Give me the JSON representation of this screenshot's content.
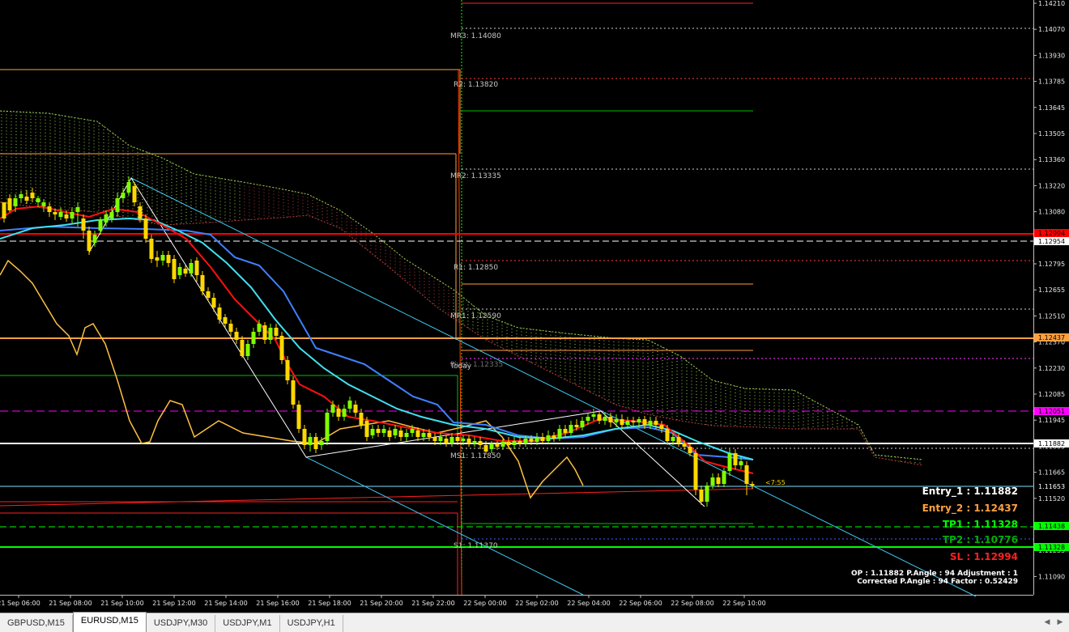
{
  "price_axis": {
    "ticks": [
      "1.14210",
      "1.14070",
      "1.13930",
      "1.13785",
      "1.13645",
      "1.13505",
      "1.13360",
      "1.13220",
      "1.13080",
      "1.12935",
      "1.12795",
      "1.12655",
      "1.12510",
      "1.12370",
      "1.12230",
      "1.12085",
      "1.11945",
      "1.11805",
      "1.11665",
      "1.11520",
      "1.11380",
      "1.11235",
      "1.11090"
    ],
    "tags": [
      {
        "text": "1.12994",
        "bg": "#ff0000",
        "fg": "#000000"
      },
      {
        "text": "1.12954",
        "bg": "#ffffff",
        "fg": "#000000"
      },
      {
        "text": "1.12437",
        "bg": "#ffa040",
        "fg": "#000000"
      },
      {
        "text": "1.12051",
        "bg": "#ff00ff",
        "fg": "#000000"
      },
      {
        "text": "1.11882",
        "bg": "#ffffff",
        "fg": "#000000"
      },
      {
        "text": "1.11653",
        "bg": "#000000",
        "fg": "#ffffff"
      },
      {
        "text": "1.11438",
        "bg": "#00ff00",
        "fg": "#000000"
      },
      {
        "text": "1.11328",
        "bg": "#00ff00",
        "fg": "#000000"
      }
    ]
  },
  "time_axis": [
    "21 Sep 06:00",
    "21 Sep 08:00",
    "21 Sep 10:00",
    "21 Sep 12:00",
    "21 Sep 14:00",
    "21 Sep 16:00",
    "21 Sep 18:00",
    "21 Sep 20:00",
    "21 Sep 22:00",
    "22 Sep 00:00",
    "22 Sep 02:00",
    "22 Sep 04:00",
    "22 Sep 06:00",
    "22 Sep 08:00",
    "22 Sep 10:00"
  ],
  "pivots": [
    {
      "label": "MR3: 1.14080"
    },
    {
      "label": "R2: 1.13820"
    },
    {
      "label": "MR2: 1.13335"
    },
    {
      "label": "R1: 1.12850"
    },
    {
      "label": "MR1: 1.12590"
    },
    {
      "label": "Today"
    },
    {
      "label": "Pivot: 1.12335"
    },
    {
      "label": "MS1: 1.11850"
    },
    {
      "label": "S1: 1.11370"
    }
  ],
  "countdown": "<7:55",
  "trade_info": {
    "entry1": "Entry_1 : 1.11882",
    "entry2": "Entry_2 : 1.12437",
    "tp1": "TP1 : 1.11328",
    "tp2": "TP2 : 1.10776",
    "sl": "SL : 1.12994",
    "op_line": "OP : 1.11882   P.Angle : 94   Adjustment : 1",
    "corrected_line": "Corrected P.Angle : 94   Factor : 0.52429"
  },
  "colors": {
    "entry1": "#ffffff",
    "entry2": "#ffa040",
    "tp1": "#00ff00",
    "tp2": "#00b000",
    "sl": "#ff2020",
    "bull": "#7fff00",
    "bear": "#ffd700",
    "ma_red": "#ff1010",
    "ma_cyan": "#40e0f0",
    "ma_blue": "#4080ff",
    "chikou": "#ffc040"
  },
  "tabs": [
    {
      "label": "GBPUSD,M15",
      "active": false
    },
    {
      "label": "EURUSD,M15",
      "active": true
    },
    {
      "label": "USDJPY,M30",
      "active": false
    },
    {
      "label": "USDJPY,M1",
      "active": false
    },
    {
      "label": "USDJPY,H1",
      "active": false
    }
  ]
}
